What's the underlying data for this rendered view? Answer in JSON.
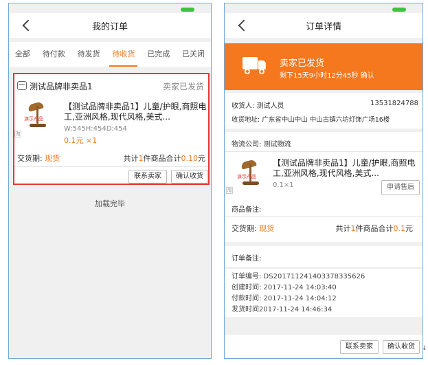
{
  "left": {
    "title": "我的订单",
    "tabs": [
      "全部",
      "待付款",
      "待发货",
      "待收货",
      "已完成",
      "已关闭"
    ],
    "active_tab": 3,
    "order": {
      "shop_name": "测试品牌非卖品1",
      "status": "卖家已发货",
      "product_title": "【测试品牌非卖品1】儿童/护眼,商照电工,亚洲风格,现代风格,美式...",
      "spec": "W:545H:454D:454",
      "price_qty": "0.1元 ×1",
      "demo_label": "演示产品",
      "side_mark": "淘",
      "delivery_label": "交货期:",
      "delivery_value": "现货",
      "total_prefix": "共计",
      "total_count": "1",
      "total_mid": "件商品合计",
      "total_amount": "0.10",
      "total_suffix": "元",
      "btn_contact": "联系卖家",
      "btn_confirm": "确认收货"
    },
    "load_done": "加载完毕"
  },
  "right": {
    "title": "订单详情",
    "banner_title": "卖家已发货",
    "banner_sub": "剩下15天9小时12分45秒  确认",
    "receiver_label": "收货人: 测试人员",
    "receiver_phone": "13531824788",
    "address": "收货地址: 广东省中山中山 中山古镇六坊灯饰广场16楼",
    "logistics": "物流公司: 测试物流",
    "product_title": "【测试品牌非卖品1】儿童/护眼,商照电工,亚洲风格,现代风格,美式...",
    "demo_label": "演示产品",
    "side_mark": "淘",
    "qty": "0.1×1",
    "btn_after_sale": "申请售后",
    "goods_note": "商品备注:",
    "delivery_label": "交货期:",
    "delivery_value": "现货",
    "total_prefix": "共计",
    "total_count": "1",
    "total_mid": "件商品合计",
    "total_amount": "0.1",
    "total_suffix": "元",
    "order_note": "订单备注:",
    "order_no": "订单编号: DS201711241403378335626",
    "created": "创建时间: 2017-11-24 14:03:40",
    "paid": "付款时间: 2017-11-24 14:04:12",
    "shipped": "发货时间2017-11-24 14:46:34",
    "btn_contact": "联系卖家",
    "btn_confirm": "确认收货"
  },
  "colors": {
    "accent": "#f07a1a",
    "banner": "#f5771e",
    "highlight_border": "#e53935",
    "battery": "#3fc23f"
  },
  "corner_glyph": "↓"
}
